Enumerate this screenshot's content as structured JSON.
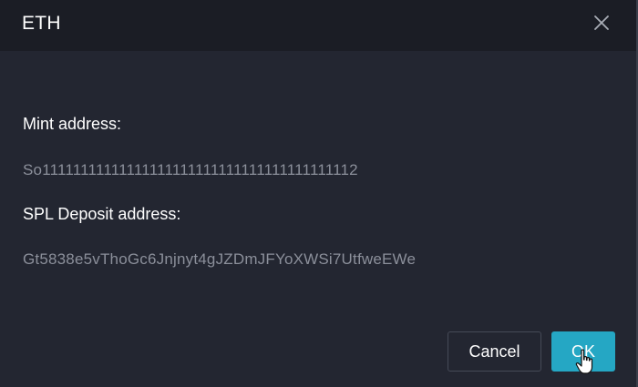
{
  "dialog": {
    "title": "ETH",
    "close_icon": "close-icon",
    "fields": [
      {
        "label": "Mint address:",
        "value": "So11111111111111111111111111111111111111112"
      },
      {
        "label": "SPL Deposit address:",
        "value": "Gt5838e5vThoGc6Jnjnyt4gJZDmJFYoXWSi7UtfweEWe"
      }
    ],
    "buttons": {
      "cancel_label": "Cancel",
      "ok_label": "OK"
    }
  },
  "colors": {
    "background": "#232631",
    "header": "#1b1d25",
    "accent": "#25a7c4",
    "value_text": "#8b8f9a"
  },
  "cursor_icon": "hand-pointer-icon"
}
